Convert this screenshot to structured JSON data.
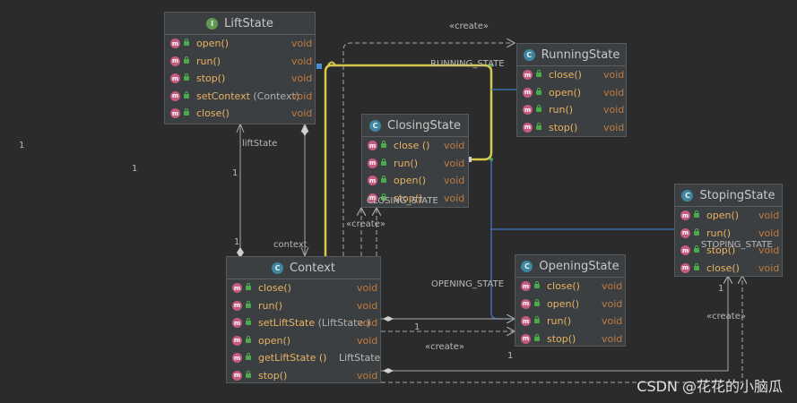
{
  "classes": {
    "liftstate": {
      "name": "LiftState",
      "methods": [
        {
          "name": "open()",
          "param": "",
          "ret": "void"
        },
        {
          "name": "run()",
          "param": "",
          "ret": "void"
        },
        {
          "name": "stop()",
          "param": "",
          "ret": "void"
        },
        {
          "name": "setContext",
          "param": "(Context)",
          "ret": "void"
        },
        {
          "name": "close()",
          "param": "",
          "ret": "void"
        }
      ]
    },
    "runningstate": {
      "name": "RunningState",
      "methods": [
        {
          "name": "close()",
          "ret": "void"
        },
        {
          "name": "open()",
          "ret": "void"
        },
        {
          "name": "run()",
          "ret": "void"
        },
        {
          "name": "stop()",
          "ret": "void"
        }
      ]
    },
    "closingstate": {
      "name": "ClosingState",
      "methods": [
        {
          "name": "close ()",
          "ret": "void"
        },
        {
          "name": "run()",
          "ret": "void"
        },
        {
          "name": "open()",
          "ret": "void"
        },
        {
          "name": "stop()",
          "ret": "void"
        }
      ]
    },
    "stopingstate": {
      "name": "StopingState",
      "methods": [
        {
          "name": "open()",
          "ret": "void"
        },
        {
          "name": "run()",
          "ret": "void"
        },
        {
          "name": "stop()",
          "ret": "void"
        },
        {
          "name": "close()",
          "ret": "void"
        }
      ]
    },
    "openingstate": {
      "name": "OpeningState",
      "methods": [
        {
          "name": "close()",
          "ret": "void"
        },
        {
          "name": "open()",
          "ret": "void"
        },
        {
          "name": "run()",
          "ret": "void"
        },
        {
          "name": "stop()",
          "ret": "void"
        }
      ]
    },
    "context": {
      "name": "Context",
      "methods": [
        {
          "name": "close()",
          "param": "",
          "ret": "void"
        },
        {
          "name": "run()",
          "param": "",
          "ret": "void"
        },
        {
          "name": "setLiftState",
          "param": "(LiftState )",
          "ret": "void"
        },
        {
          "name": "open()",
          "param": "",
          "ret": "void"
        },
        {
          "name": "getLiftState ()",
          "param": "",
          "ret": "LiftState"
        },
        {
          "name": "stop()",
          "param": "",
          "ret": "void"
        }
      ]
    }
  },
  "labels": {
    "create_top": "«create»",
    "create_mid": "«create»",
    "create_bottom": "«create»",
    "create_right": "«create»",
    "running_state": "RUNNING_STATE",
    "closing_state": "CLOSING_STATE",
    "stoping_state": "STOPING_STATE",
    "opening_state": "OPENING_STATE",
    "liftstate_role": "liftState",
    "context_role": "context",
    "m_left1": "1",
    "m_left2": "1",
    "m_lift1": "1",
    "m_lift2": "1",
    "m_ctx_open": "1",
    "m_bottom": "1",
    "m_stop": "1"
  },
  "watermark": "CSDN @花花的小脑瓜",
  "colors": {
    "background": "#2b2b2b",
    "class_fill": "#3c3f41",
    "method_name": "#e8b363",
    "return_type": "#c07a3e",
    "highlight_edge": "#d8c84c",
    "assoc_edge": "#3d79c2",
    "dashed_edge": "#a9a9a9"
  }
}
